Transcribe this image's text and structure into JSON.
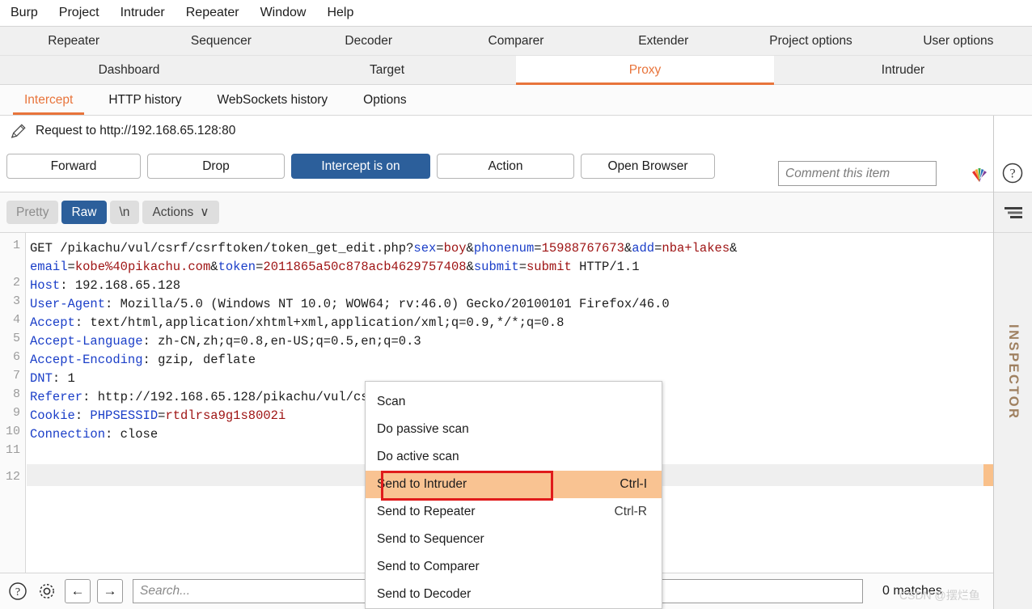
{
  "menubar": {
    "items": [
      {
        "label": "Burp"
      },
      {
        "label": "Project"
      },
      {
        "label": "Intruder"
      },
      {
        "label": "Repeater"
      },
      {
        "label": "Window"
      },
      {
        "label": "Help"
      }
    ]
  },
  "main_tabs_row1": [
    {
      "label": "Repeater",
      "active": false
    },
    {
      "label": "Sequencer",
      "active": false
    },
    {
      "label": "Decoder",
      "active": false
    },
    {
      "label": "Comparer",
      "active": false
    },
    {
      "label": "Extender",
      "active": false
    },
    {
      "label": "Project options",
      "active": false
    },
    {
      "label": "User options",
      "active": false
    }
  ],
  "main_tabs_row2": [
    {
      "label": "Dashboard",
      "active": false
    },
    {
      "label": "Target",
      "active": false
    },
    {
      "label": "Proxy",
      "active": true
    },
    {
      "label": "Intruder",
      "active": false
    }
  ],
  "sub_tabs": [
    {
      "label": "Intercept",
      "active": true
    },
    {
      "label": "HTTP history",
      "active": false
    },
    {
      "label": "WebSockets history",
      "active": false
    },
    {
      "label": "Options",
      "active": false
    }
  ],
  "request_bar": {
    "title": "Request to http://192.168.65.128:80",
    "buttons": {
      "forward": "Forward",
      "drop": "Drop",
      "intercept": "Intercept is on",
      "action": "Action",
      "open_browser": "Open Browser"
    },
    "comment_placeholder": "Comment this item"
  },
  "format_bar": {
    "pretty": "Pretty",
    "raw": "Raw",
    "newline": "\\n",
    "actions": "Actions",
    "actions_caret": "∨"
  },
  "inspector": {
    "label": "INSPECTOR"
  },
  "editor": {
    "line_numbers": [
      "1",
      "2",
      "3",
      "4",
      "5",
      "6",
      "7",
      "8",
      "9",
      "10",
      "11",
      "12"
    ],
    "current_line": 11,
    "request_lines": [
      {
        "n": 1,
        "parts": [
          {
            "t": "GET /pikachu/vul/csrf/csrftoken/token_get_edit.php?",
            "c": "plain"
          },
          {
            "t": "sex",
            "c": "name"
          },
          {
            "t": "=",
            "c": "plain"
          },
          {
            "t": "boy",
            "c": "val"
          },
          {
            "t": "&",
            "c": "plain"
          },
          {
            "t": "phonenum",
            "c": "name"
          },
          {
            "t": "=",
            "c": "plain"
          },
          {
            "t": "15988767673",
            "c": "val"
          },
          {
            "t": "&",
            "c": "plain"
          },
          {
            "t": "add",
            "c": "name"
          },
          {
            "t": "=",
            "c": "plain"
          },
          {
            "t": "nba+lakes",
            "c": "val"
          },
          {
            "t": "&",
            "c": "plain"
          }
        ]
      },
      {
        "n": "1b",
        "parts": [
          {
            "t": "email",
            "c": "name"
          },
          {
            "t": "=",
            "c": "plain"
          },
          {
            "t": "kobe%40pikachu.com",
            "c": "val"
          },
          {
            "t": "&",
            "c": "plain"
          },
          {
            "t": "token",
            "c": "name"
          },
          {
            "t": "=",
            "c": "plain"
          },
          {
            "t": "2011865a50c878acb4629757408",
            "c": "val"
          },
          {
            "t": "&",
            "c": "plain"
          },
          {
            "t": "submit",
            "c": "name"
          },
          {
            "t": "=",
            "c": "plain"
          },
          {
            "t": "submit",
            "c": "val"
          },
          {
            "t": " HTTP/1.1",
            "c": "plain"
          }
        ]
      },
      {
        "n": 2,
        "parts": [
          {
            "t": "Host",
            "c": "name"
          },
          {
            "t": ": 192.168.65.128",
            "c": "plain"
          }
        ]
      },
      {
        "n": 3,
        "parts": [
          {
            "t": "User-Agent",
            "c": "name"
          },
          {
            "t": ": Mozilla/5.0 (Windows NT 10.0; WOW64; rv:46.0) Gecko/20100101 Firefox/46.0",
            "c": "plain"
          }
        ]
      },
      {
        "n": 4,
        "parts": [
          {
            "t": "Accept",
            "c": "name"
          },
          {
            "t": ": text/html,application/xhtml+xml,application/xml;q=0.9,*/*;q=0.8",
            "c": "plain"
          }
        ]
      },
      {
        "n": 5,
        "parts": [
          {
            "t": "Accept-Language",
            "c": "name"
          },
          {
            "t": ": zh-CN,zh;q=0.8,en-US;q=0.5,en;q=0.3",
            "c": "plain"
          }
        ]
      },
      {
        "n": 6,
        "parts": [
          {
            "t": "Accept-Encoding",
            "c": "name"
          },
          {
            "t": ": gzip, deflate",
            "c": "plain"
          }
        ]
      },
      {
        "n": 7,
        "parts": [
          {
            "t": "DNT",
            "c": "name"
          },
          {
            "t": ": 1",
            "c": "plain"
          }
        ]
      },
      {
        "n": 8,
        "parts": [
          {
            "t": "Referer",
            "c": "name"
          },
          {
            "t": ": http://192.168.65.128/pikachu/vul/csrf/csrftoken/token_get_edit.php",
            "c": "plain"
          }
        ]
      },
      {
        "n": 9,
        "parts": [
          {
            "t": "Cookie",
            "c": "name"
          },
          {
            "t": ": ",
            "c": "plain"
          },
          {
            "t": "PHPSESSID",
            "c": "name"
          },
          {
            "t": "=",
            "c": "plain"
          },
          {
            "t": "rtdlrsa9g1s8002i",
            "c": "val"
          }
        ]
      },
      {
        "n": 10,
        "parts": [
          {
            "t": "Connection",
            "c": "name"
          },
          {
            "t": ": close",
            "c": "plain"
          }
        ]
      }
    ]
  },
  "context_menu": {
    "items": [
      {
        "label": "Scan",
        "accel": "",
        "selected": false
      },
      {
        "label": "Do passive scan",
        "accel": "",
        "selected": false
      },
      {
        "label": "Do active scan",
        "accel": "",
        "selected": false
      },
      {
        "label": "Send to Intruder",
        "accel": "Ctrl-I",
        "selected": true
      },
      {
        "label": "Send to Repeater",
        "accel": "Ctrl-R",
        "selected": false
      },
      {
        "label": "Send to Sequencer",
        "accel": "",
        "selected": false
      },
      {
        "label": "Send to Comparer",
        "accel": "",
        "selected": false
      },
      {
        "label": "Send to Decoder",
        "accel": "",
        "selected": false
      }
    ]
  },
  "bottom_bar": {
    "help_icon": "?",
    "settings_icon": "gear",
    "prev_icon": "←",
    "next_icon": "→",
    "search_placeholder": "Search...",
    "matches": "0 matches"
  },
  "watermark": "CSDN @摆烂鱼",
  "colors": {
    "accent_orange": "#e8743b",
    "button_blue": "#2C5F9B",
    "menu_highlight": "#F9C392",
    "annotation_red": "#e01b1b",
    "header_name_blue": "#1a3ec8",
    "header_value_red": "#9e1313",
    "inspector_tan": "#9f8060"
  }
}
